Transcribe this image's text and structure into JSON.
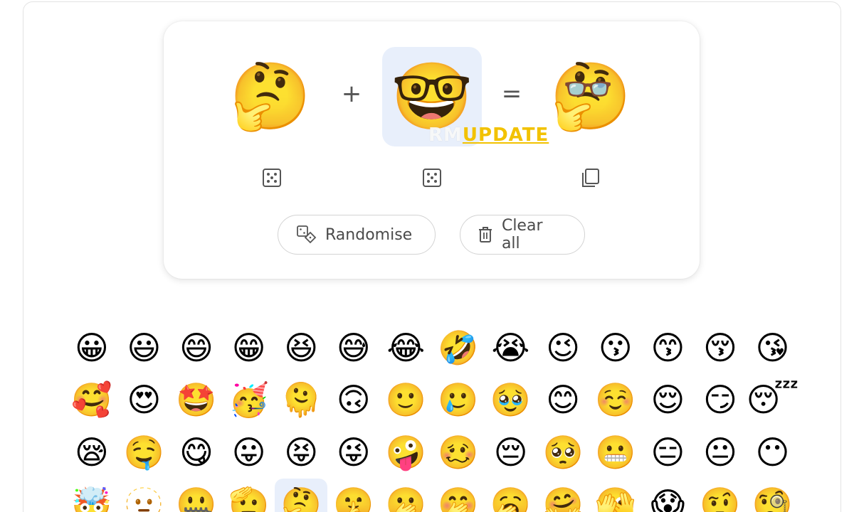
{
  "mixer": {
    "left_emoji": "🤔",
    "plus": "+",
    "middle_emoji": "🤓",
    "equals": "=",
    "result_emoji": "🤔",
    "result_glasses": "👓"
  },
  "watermark": {
    "part_a": "RM",
    "part_b": "UPDATE"
  },
  "controls": {
    "randomise_label": "Randomise",
    "clear_all_label": "Clear all"
  },
  "icons": {
    "left_dice": "dice-icon",
    "middle_dice": "dice-icon",
    "result_copy": "copy-icon",
    "randomise": "dice-shapes-icon",
    "clear_all": "trash-icon"
  },
  "colors": {
    "selected_bg": "#e8effb",
    "watermark_yellow": "#f2c200"
  },
  "emoji_grid": {
    "selected_index": 46,
    "items": [
      "😀",
      "😃",
      "😄",
      "😁",
      "😆",
      "😅",
      "😂",
      "🤣",
      "😭",
      "😉",
      "😗",
      "😙",
      "😚",
      "😘",
      "🥰",
      "😍",
      "🤩",
      "🥳",
      "🫠",
      "🙃",
      "🙂",
      "🥲",
      "🥹",
      "😊",
      "☺️",
      "😌",
      "😏",
      "😴",
      "😪",
      "🤤",
      "😋",
      "😛",
      "😝",
      "😜",
      "🤪",
      "🥴",
      "😔",
      "🥺",
      "😬",
      "😑",
      "😐",
      "😶",
      "🤯",
      "🫥",
      "🤐",
      "🫡",
      "🤔",
      "🤫",
      "🫢",
      "🤭",
      "🥱",
      "🤗",
      "🫣",
      "😱",
      "🤨",
      "🧐"
    ]
  }
}
